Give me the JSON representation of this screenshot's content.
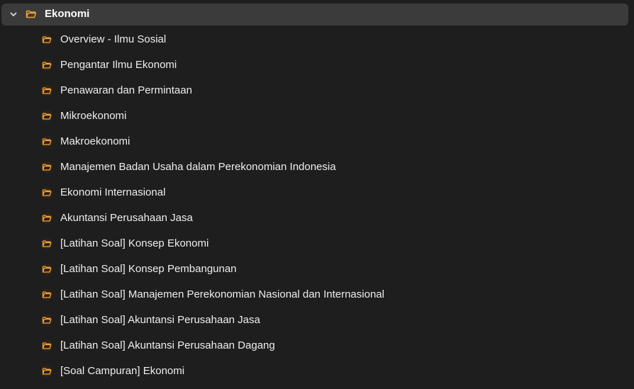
{
  "colors": {
    "background": "#1e1e1e",
    "selected_row": "#3b3b3b",
    "folder_accent": "#f2a43a",
    "text": "#eeeeee"
  },
  "root": {
    "label": "Ekonomi",
    "expanded": true,
    "chevron_icon": "chevron-down-icon",
    "folder_icon": "folder-open-icon"
  },
  "children": [
    {
      "label": "Overview - Ilmu Sosial",
      "icon": "folder-open-icon"
    },
    {
      "label": "Pengantar Ilmu Ekonomi",
      "icon": "folder-open-icon"
    },
    {
      "label": "Penawaran dan Permintaan",
      "icon": "folder-open-icon"
    },
    {
      "label": "Mikroekonomi",
      "icon": "folder-open-icon"
    },
    {
      "label": "Makroekonomi",
      "icon": "folder-open-icon"
    },
    {
      "label": "Manajemen Badan Usaha dalam Perekonomian Indonesia",
      "icon": "folder-open-icon"
    },
    {
      "label": "Ekonomi Internasional",
      "icon": "folder-open-icon"
    },
    {
      "label": "Akuntansi Perusahaan Jasa",
      "icon": "folder-open-icon"
    },
    {
      "label": "[Latihan Soal] Konsep Ekonomi",
      "icon": "folder-open-icon"
    },
    {
      "label": "[Latihan Soal] Konsep Pembangunan",
      "icon": "folder-open-icon"
    },
    {
      "label": "[Latihan Soal] Manajemen Perekonomian Nasional dan Internasional",
      "icon": "folder-open-icon"
    },
    {
      "label": "[Latihan Soal] Akuntansi Perusahaan Jasa",
      "icon": "folder-open-icon"
    },
    {
      "label": "[Latihan Soal] Akuntansi Perusahaan Dagang",
      "icon": "folder-open-icon"
    },
    {
      "label": "[Soal Campuran] Ekonomi",
      "icon": "folder-open-icon"
    }
  ]
}
